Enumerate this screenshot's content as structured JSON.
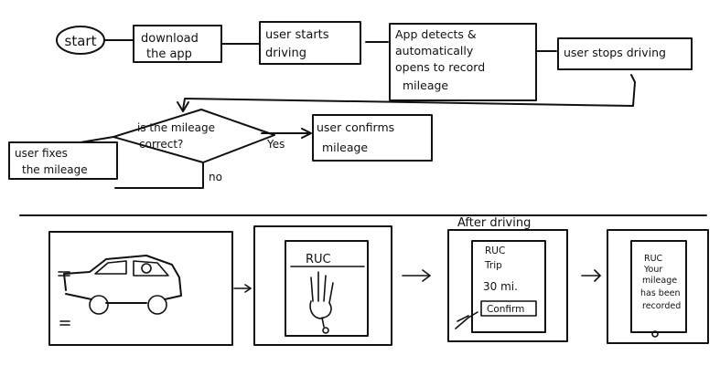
{
  "flow": {
    "start": "start",
    "download": [
      "download",
      "the app"
    ],
    "starts_driving": [
      "user starts",
      "driving"
    ],
    "app_detects": [
      "App detects &",
      "automatically",
      "opens to record",
      "mileage"
    ],
    "stops_driving": "user stops driving",
    "decision": [
      "is the mileage",
      "correct?"
    ],
    "yes_label": "Yes",
    "no_label": "no",
    "confirms": [
      "user confirms",
      "mileage"
    ],
    "fixes": [
      "user fixes",
      "the mileage"
    ]
  },
  "storyboard": {
    "after_driving": "After driving",
    "phone1": {
      "header": "RUC"
    },
    "phone2": {
      "lines": [
        "RUC",
        "Trip",
        "30 mi."
      ],
      "button": "Confirm"
    },
    "phone3": {
      "lines": [
        "RUC",
        "Your",
        "mileage",
        "has been",
        "recorded"
      ]
    }
  }
}
